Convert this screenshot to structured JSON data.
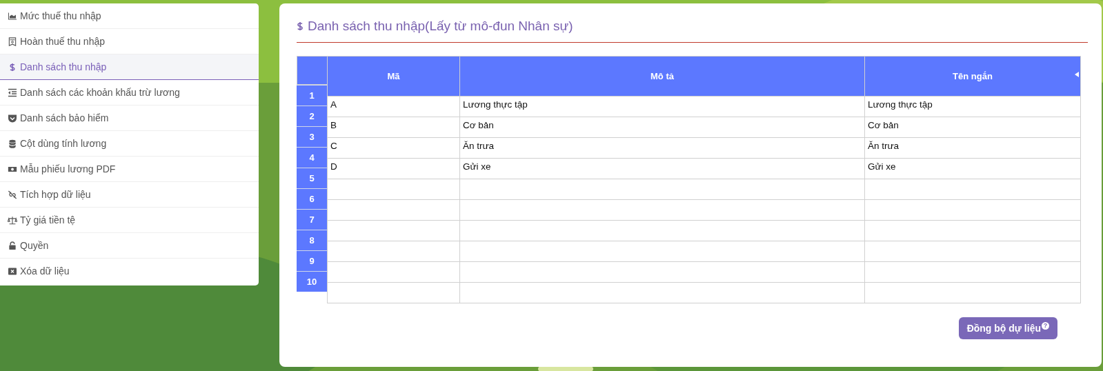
{
  "sidebar": {
    "items": [
      {
        "label": "Mức thuế thu nhập",
        "selected": false
      },
      {
        "label": "Hoàn thuế thu nhập",
        "selected": false
      },
      {
        "label": "Danh sách thu nhập",
        "selected": true
      },
      {
        "label": "Danh sách các khoản khấu trừ lương",
        "selected": false
      },
      {
        "label": "Danh sách bảo hiểm",
        "selected": false
      },
      {
        "label": "Cột dùng tính lương",
        "selected": false
      },
      {
        "label": "Mẫu phiếu lương PDF",
        "selected": false
      },
      {
        "label": "Tích hợp dữ liệu",
        "selected": false
      },
      {
        "label": "Tỷ giá tiền tệ",
        "selected": false
      },
      {
        "label": "Quyền",
        "selected": false
      },
      {
        "label": "Xóa dữ liệu",
        "selected": false
      }
    ]
  },
  "panel": {
    "title": "Danh sách thu nhập(Lấy từ mô-đun Nhân sự)",
    "table": {
      "columns": [
        "Mã",
        "Mô tả",
        "Tên ngắn"
      ],
      "row_numbers": [
        "1",
        "2",
        "3",
        "4",
        "5",
        "6",
        "7",
        "8",
        "9",
        "10"
      ],
      "rows": [
        [
          "A",
          "Lương thực tập",
          "Lương thực tập"
        ],
        [
          "B",
          "Cơ bản",
          "Cơ bản"
        ],
        [
          "C",
          "Ăn trưa",
          "Ăn trưa"
        ],
        [
          "D",
          "Gửi xe",
          "Gửi xe"
        ],
        [
          "",
          "",
          ""
        ],
        [
          "",
          "",
          ""
        ],
        [
          "",
          "",
          ""
        ],
        [
          "",
          "",
          ""
        ],
        [
          "",
          "",
          ""
        ],
        [
          "",
          "",
          ""
        ]
      ]
    },
    "sync_button": {
      "label": "Đồng bộ dự liệu",
      "help_mark": "?"
    }
  }
}
